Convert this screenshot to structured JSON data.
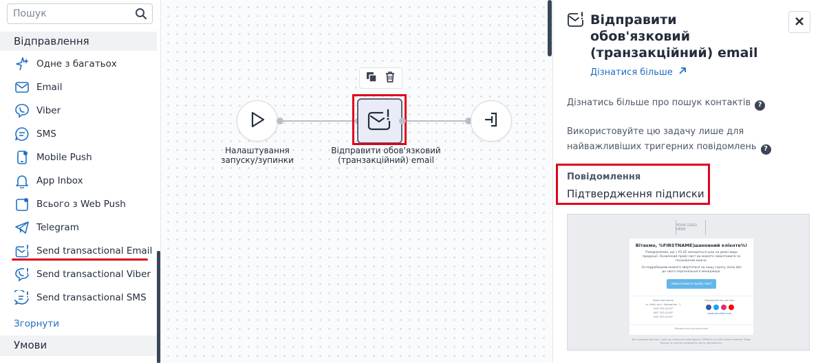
{
  "sidebar": {
    "search_placeholder": "Пошук",
    "section_send": "Відправлення",
    "items": [
      {
        "label": "Одне з багатьох",
        "icon": "sparkle-icon"
      },
      {
        "label": "Email",
        "icon": "envelope-icon"
      },
      {
        "label": "Viber",
        "icon": "viber-icon"
      },
      {
        "label": "SMS",
        "icon": "sms-bubble-icon"
      },
      {
        "label": "Mobile Push",
        "icon": "mobile-push-icon"
      },
      {
        "label": "App Inbox",
        "icon": "bell-icon"
      },
      {
        "label": "Всього з Web Push",
        "icon": "web-push-icon"
      },
      {
        "label": "Telegram",
        "icon": "telegram-icon"
      },
      {
        "label": "Send transactional Email",
        "icon": "transactional-email-icon"
      },
      {
        "label": "Send transactional Viber",
        "icon": "transactional-viber-icon"
      },
      {
        "label": "Send transactional SMS",
        "icon": "transactional-sms-icon"
      }
    ],
    "collapse_label": "Згорнути",
    "section_conditions": "Умови"
  },
  "canvas": {
    "nodes": [
      {
        "label": "Налаштування запуску/зупинки",
        "icon": "play-icon"
      },
      {
        "label": "Відправити обов'язковий (транзакційний) email",
        "icon": "transactional-email-icon"
      },
      {
        "label": "",
        "icon": "exit-icon"
      }
    ],
    "toolbar": {
      "copy_icon": "copy-icon",
      "delete_icon": "trash-icon"
    }
  },
  "panel": {
    "title": "Відправити обов'язковий (транзакційний) email",
    "learn_more": "Дізнатися більше",
    "contacts_help": "Дізнатись більше про пошук контактів",
    "usage_hint": "Використовуйте цю задачу лише для найважливіших тригерних повідомлень",
    "message_label": "Повідомлення",
    "message_value": "Підтвердження підписки",
    "preview": {
      "logo": "YOUR LOGO HERE",
      "heading": "Вітаємо, %FIRSTNAME|шановний клієнте%!",
      "paragraph1": "Повідомляємо, що з 01.02 змінюються ціни на деякі види продукції. Оновлений прайс-лист ви можете завантажити за посиланням нижче.",
      "paragraph2": "За подробицями можете звертатися на нашу гарячу лінію або до свого персонального менеджера.",
      "button": "Завантажити прайс-лист",
      "address_title": "Наші контакти:",
      "address_lines": [
        "м. Київ, вул. Хрещатик, 1",
        "044 333-43-67",
        "067 333-43-67",
        "093 333-43-67"
      ],
      "follow_title": "Приєднуйтесь до нас:",
      "site": "www.yoursite.com",
      "unsubscribe": "Відписатися від розсилки",
      "disclaimer": "Ви отримали цей лист, тому що залишили свою адресу %EMAIL% на сайті нашої компанії. Якщо більше не хочете отримувати листи, відпишіться."
    }
  },
  "colors": {
    "accent": "#1f6fc1",
    "highlight": "#e0001a",
    "text": "#232d3c",
    "node_fill": "#e9ebf6"
  }
}
